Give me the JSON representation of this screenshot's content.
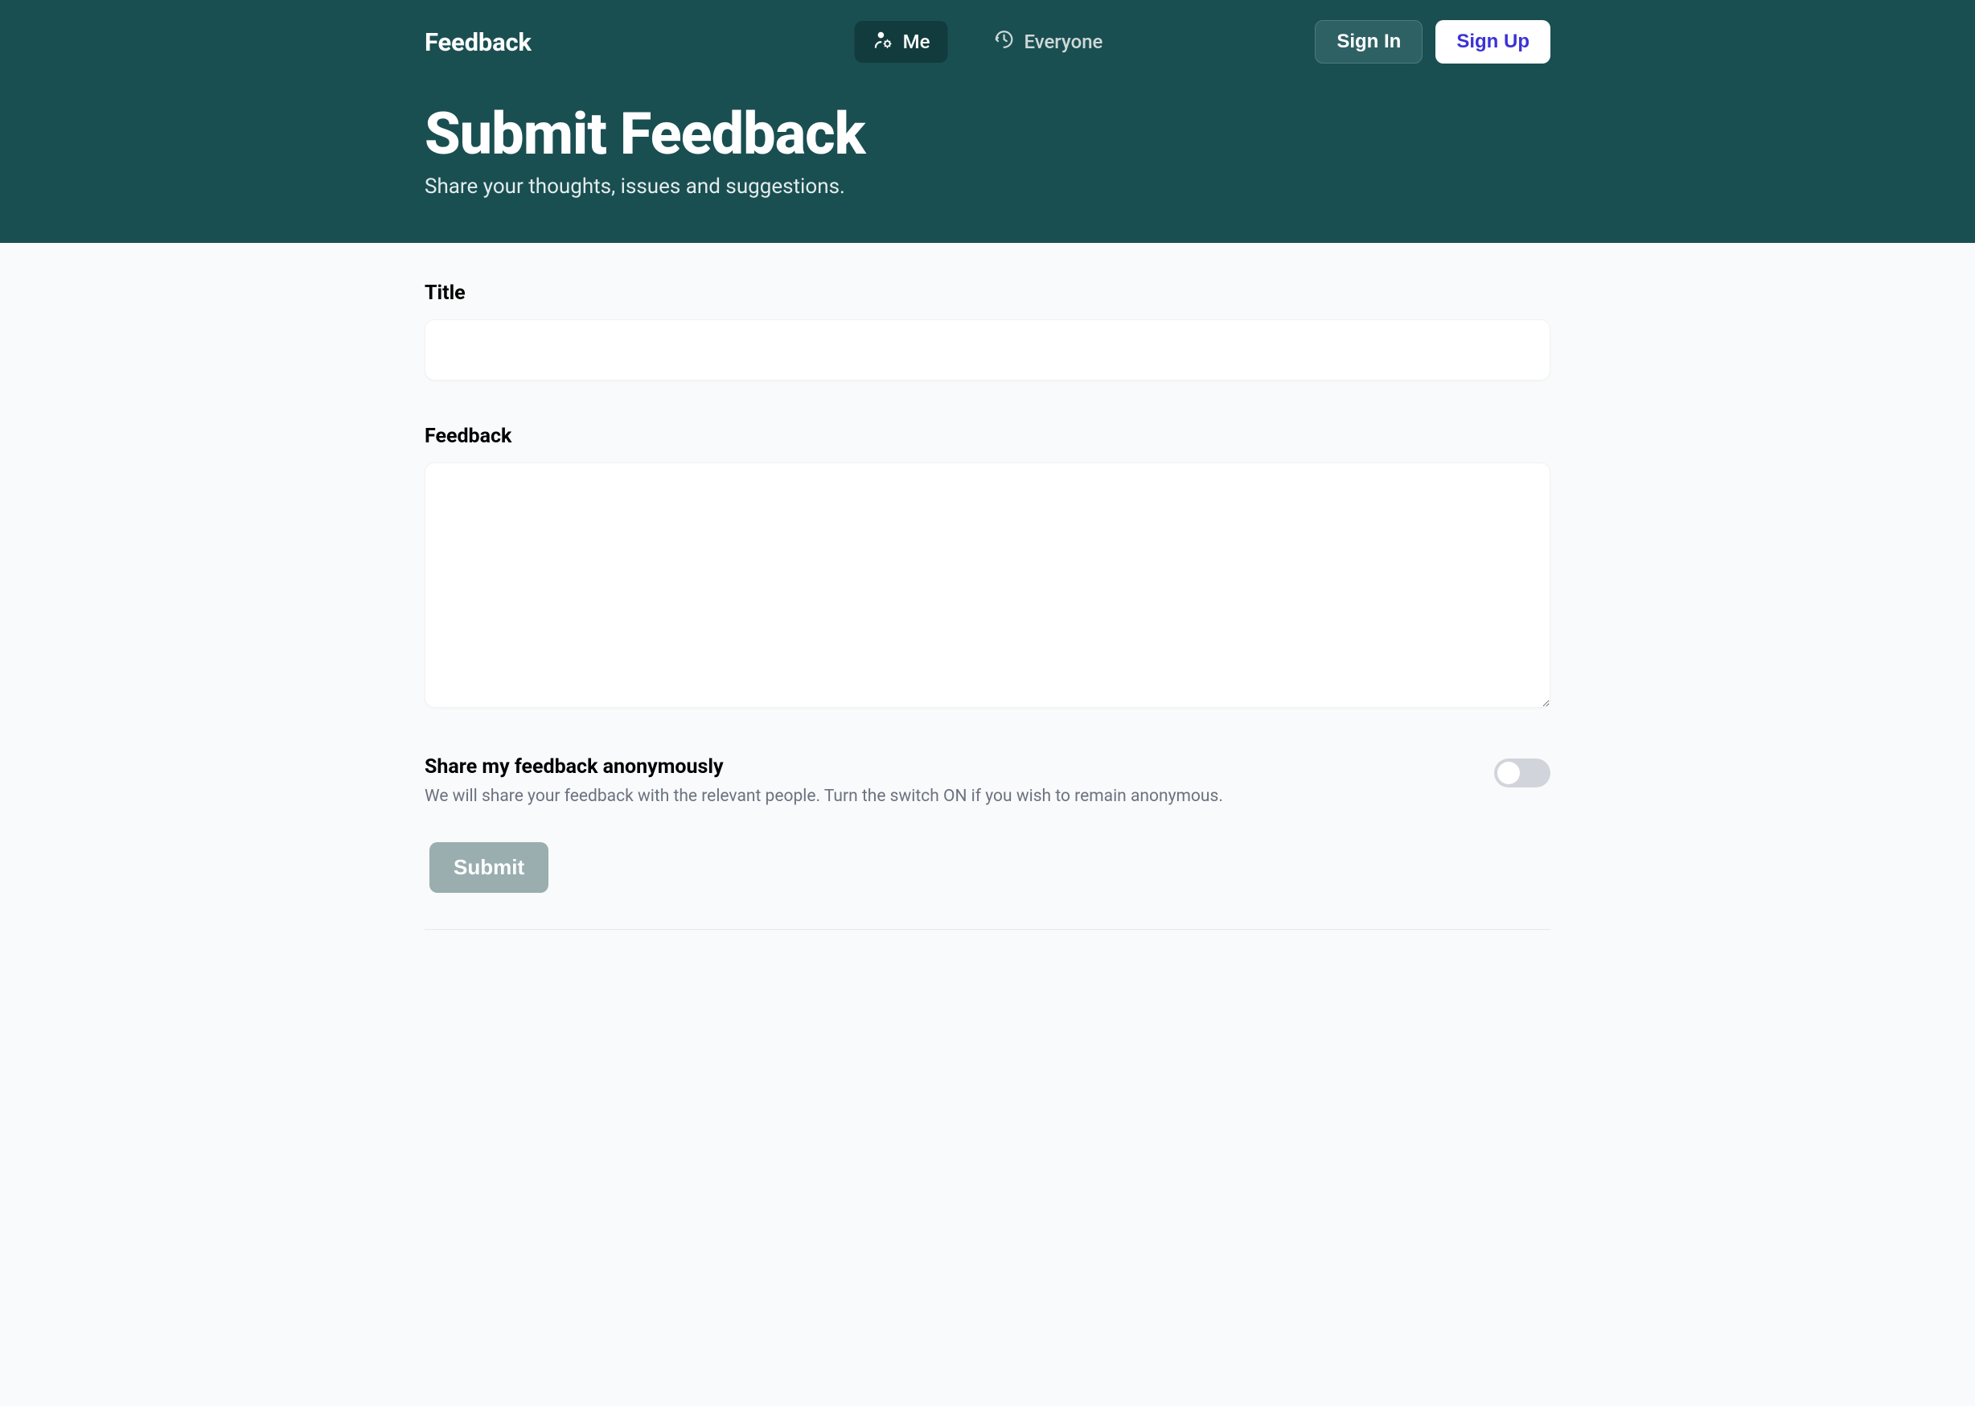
{
  "brand": "Feedback",
  "nav": {
    "me_label": "Me",
    "everyone_label": "Everyone"
  },
  "auth": {
    "sign_in": "Sign In",
    "sign_up": "Sign Up"
  },
  "header": {
    "title": "Submit Feedback",
    "subtitle": "Share your thoughts, issues and suggestions."
  },
  "form": {
    "title_label": "Title",
    "title_value": "",
    "feedback_label": "Feedback",
    "feedback_value": "",
    "anon_label": "Share my feedback anonymously",
    "anon_help": "We will share your feedback with the relevant people. Turn the switch ON if you wish to remain anonymous.",
    "anon_on": false,
    "submit_label": "Submit"
  }
}
